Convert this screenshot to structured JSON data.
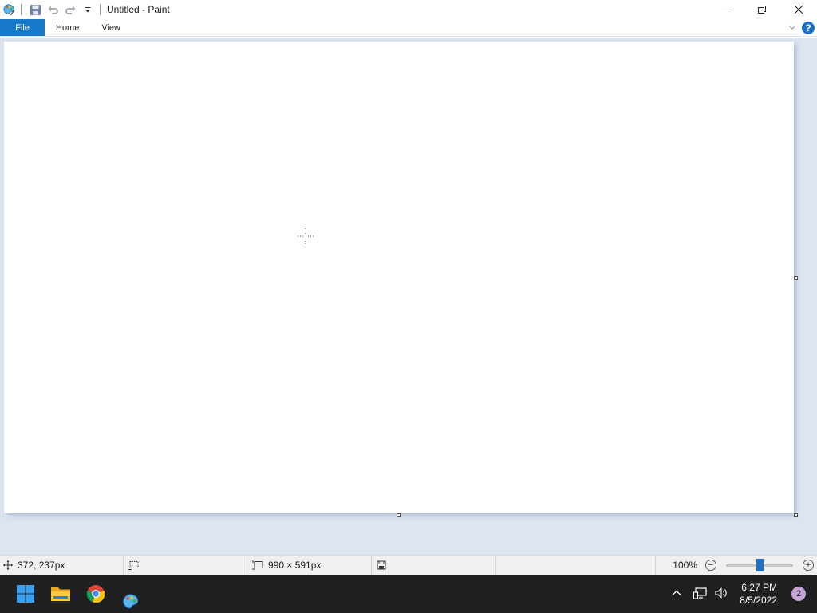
{
  "window": {
    "title": "Untitled - Paint",
    "app_icon": "paint-app-icon",
    "quick_access": [
      "save-icon",
      "undo-icon",
      "redo-icon",
      "customize-dropdown-icon"
    ],
    "controls": [
      "minimize-icon",
      "restore-icon",
      "close-icon"
    ]
  },
  "ribbon": {
    "tabs": [
      {
        "label": "File",
        "active": true
      },
      {
        "label": "Home",
        "active": false
      },
      {
        "label": "View",
        "active": false
      }
    ],
    "help_label": "?"
  },
  "status": {
    "cursor_position": "372, 237px",
    "image_size": "990 × 591px",
    "zoom_label": "100%",
    "zoom_percent": 100
  },
  "taskbar": {
    "apps": [
      "start-icon",
      "file-explorer-icon",
      "chrome-icon",
      "paint-icon"
    ],
    "time": "6:27 PM",
    "date": "8/5/2022",
    "notification_count": "2"
  },
  "colors": {
    "accent": "#1979ca",
    "workspace": "#dde5f1",
    "taskbar": "#202020"
  }
}
